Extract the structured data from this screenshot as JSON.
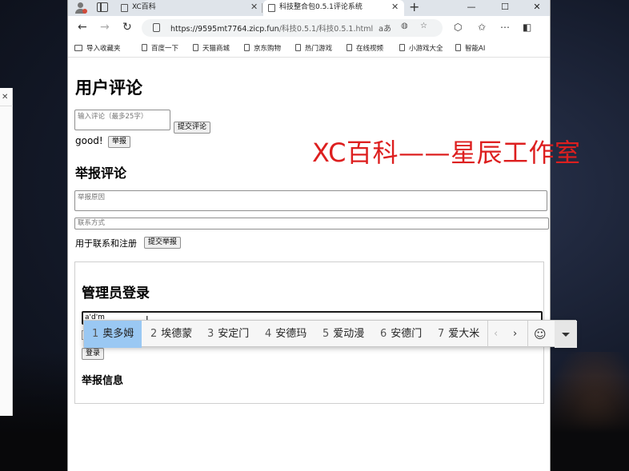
{
  "browser": {
    "tabs": [
      {
        "title": "XC百科",
        "active": false
      },
      {
        "title": "科技整合包0.5.1评论系统",
        "active": true
      }
    ],
    "url_host": "https://9595mt7764.zicp.fun",
    "url_path": "/科技0.5.1/科技0.5.1.html",
    "read_aloud_label": "aあ",
    "favorites": [
      {
        "label": "导入收藏夹",
        "icon": "folder-icon"
      },
      {
        "label": "百度一下",
        "icon": "page-icon"
      },
      {
        "label": "天猫商城",
        "icon": "page-icon"
      },
      {
        "label": "京东购物",
        "icon": "page-icon"
      },
      {
        "label": "热门游戏",
        "icon": "page-icon"
      },
      {
        "label": "在线视频",
        "icon": "page-icon"
      },
      {
        "label": "小游戏大全",
        "icon": "page-icon"
      },
      {
        "label": "智能AI",
        "icon": "page-icon"
      }
    ]
  },
  "page": {
    "title": "用户评论",
    "comment_placeholder": "输入评论（最多25字）",
    "submit_comment": "提交评论",
    "comments": [
      {
        "text": "good!",
        "report_label": "举报"
      }
    ],
    "report_heading": "举报评论",
    "report_reason_placeholder": "举报原因",
    "contact_placeholder": "联系方式",
    "contact_note": "用于联系和注册",
    "submit_report": "提交举报",
    "admin_heading": "管理员登录",
    "admin_input_value": "a'd'm",
    "login_label": "登录",
    "report_info_heading": "举报信息"
  },
  "watermark": "XC百科——星辰工作室",
  "ime": {
    "candidates": [
      {
        "num": "1",
        "text": "奥多姆",
        "selected": true
      },
      {
        "num": "2",
        "text": "埃德蒙",
        "selected": false
      },
      {
        "num": "3",
        "text": "安定门",
        "selected": false
      },
      {
        "num": "4",
        "text": "安德玛",
        "selected": false
      },
      {
        "num": "5",
        "text": "爱动漫",
        "selected": false
      },
      {
        "num": "6",
        "text": "安德门",
        "selected": false
      },
      {
        "num": "7",
        "text": "爱大米",
        "selected": false
      }
    ]
  },
  "colors": {
    "watermark": "#dd1f1f",
    "ime_selected": "#9ac8f3",
    "tab_strip": "#dfe4ea"
  }
}
